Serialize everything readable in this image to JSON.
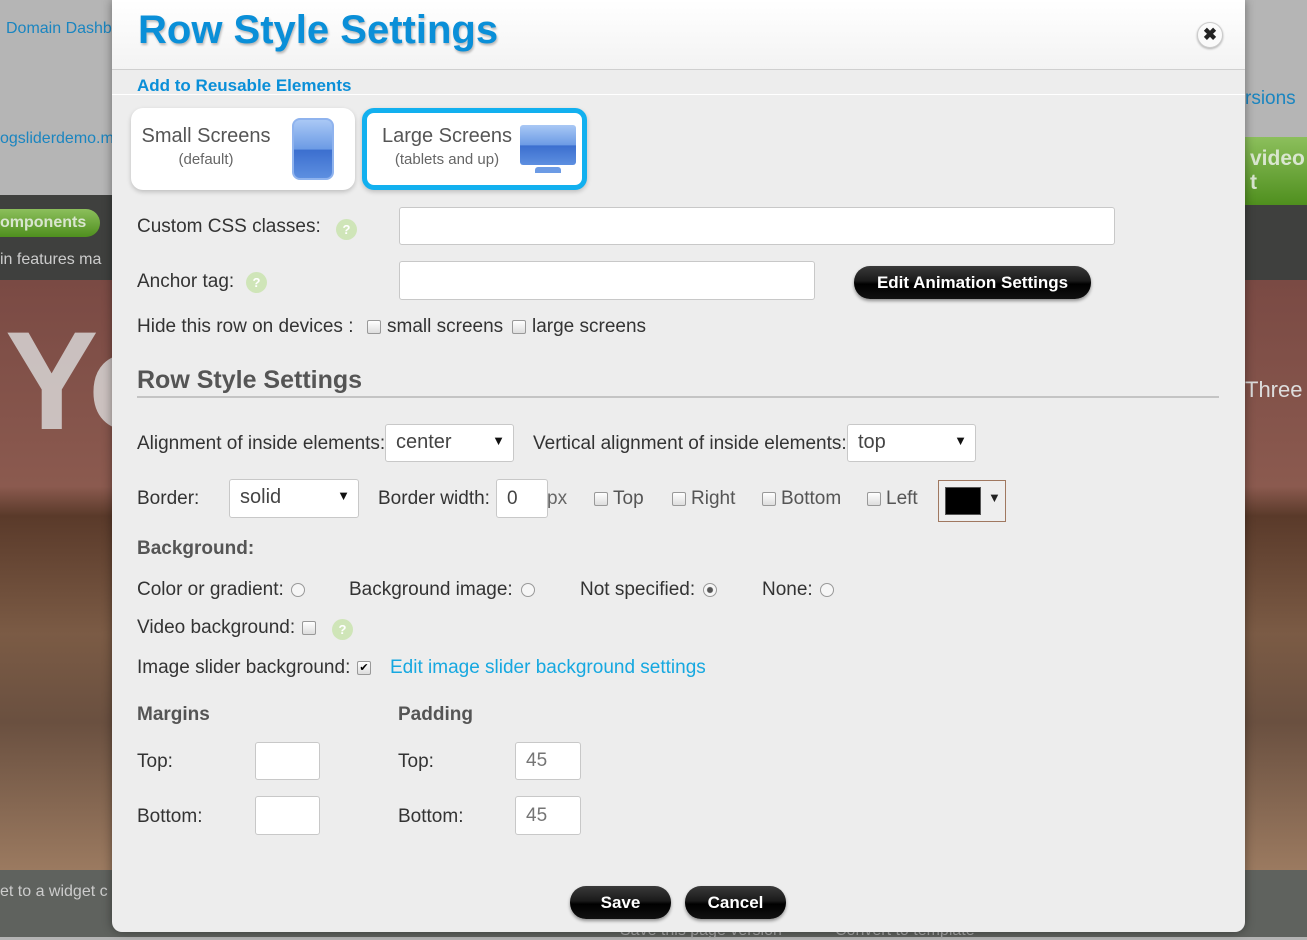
{
  "background": {
    "domain_link": "Domain Dashb",
    "site_link": "ogsliderdemo.m",
    "versions_link": "rsions",
    "components_button": "omponents",
    "video_button": "video t",
    "features_text": "in features ma",
    "hero_text": "Yo",
    "three_text": "Three",
    "widget_text": "et to a widget c",
    "save_label": "Save",
    "cancel_label": "Cancel",
    "save_version": "Save this page version",
    "convert_template": "Convert to template"
  },
  "modal": {
    "title": "Row Style Settings",
    "close_icon": "close-x-icon",
    "add_reusable": "Add to Reusable Elements",
    "devices": [
      {
        "label": "Small Screens",
        "sub": "(default)",
        "icon": "phone-icon",
        "selected": false
      },
      {
        "label": "Large Screens",
        "sub": "(tablets and up)",
        "icon": "monitor-icon",
        "selected": true
      }
    ],
    "custom_css_label": "Custom CSS classes:",
    "custom_css_value": "",
    "anchor_label": "Anchor tag:",
    "anchor_value": "",
    "help": "?",
    "edit_animation": "Edit Animation Settings",
    "hide_label": "Hide this row on devices :",
    "hide_small": "small screens",
    "hide_large": "large screens",
    "section_title": "Row Style Settings",
    "align_label": "Alignment of inside elements:",
    "align_value": "center",
    "valign_label": "Vertical alignment of inside elements:",
    "valign_value": "top",
    "border_label": "Border:",
    "border_value": "solid",
    "border_width_label": "Border width:",
    "border_width_value": "0",
    "px": "px",
    "sides": [
      "Top",
      "Right",
      "Bottom",
      "Left"
    ],
    "border_color": "#000000",
    "background_label": "Background:",
    "bg_options": [
      {
        "label": "Color or gradient:",
        "checked": false
      },
      {
        "label": "Background image:",
        "checked": false
      },
      {
        "label": "Not specified:",
        "checked": true
      },
      {
        "label": "None:",
        "checked": false
      }
    ],
    "video_bg_label": "Video background:",
    "slider_bg_label": "Image slider background:",
    "slider_bg_checked": true,
    "slider_link": "Edit image slider background settings",
    "margins_label": "Margins",
    "padding_label": "Padding",
    "top_label": "Top:",
    "bottom_label": "Bottom:",
    "margin_top": "",
    "margin_bottom": "",
    "padding_top_placeholder": "45",
    "padding_bottom_placeholder": "45",
    "save": "Save",
    "cancel": "Cancel",
    "accent": "#0a8fd8"
  }
}
